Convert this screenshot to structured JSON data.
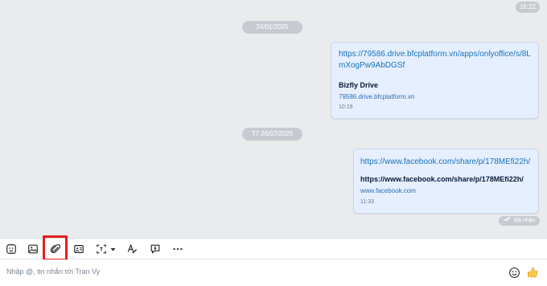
{
  "chat": {
    "top_time": "16:22",
    "messages": [
      {
        "date_divider": "24/01/2025",
        "link": "https://79586.drive.bfcplatform.vn/apps/onlyoffice/s/8LmXogPw9AbDGSf",
        "preview_title": "Bizfly Drive",
        "preview_domain": "79586.drive.bfcplatform.vn",
        "time": "10:19"
      },
      {
        "date_divider": "T7 26/07/2025",
        "link": "https://www.facebook.com/share/p/178MEfi22h/",
        "preview_title": "https://www.facebook.com/share/p/178MEfi22h/",
        "preview_domain": "www.facebook.com",
        "time": "11:33"
      }
    ],
    "delivery_status": "Đã nhận"
  },
  "toolbar": {
    "items": [
      {
        "name": "sticker-icon"
      },
      {
        "name": "image-icon"
      },
      {
        "name": "attachment-icon"
      },
      {
        "name": "contact-card-icon"
      },
      {
        "name": "screenshot-icon"
      },
      {
        "name": "text-format-icon"
      },
      {
        "name": "quick-message-icon"
      },
      {
        "name": "more-icon"
      }
    ],
    "highlighted": "attachment-icon",
    "highlight_color": "#e0201f"
  },
  "composer": {
    "placeholder": "Nhập @, tin nhắn tới Tran Vy",
    "emoji_icon": "emoji-icon",
    "send_icon": "thumbs-up-icon"
  },
  "colors": {
    "bubble_bg": "#e5efff",
    "link": "#1a73b8",
    "chip_bg": "#c7cbd1"
  }
}
